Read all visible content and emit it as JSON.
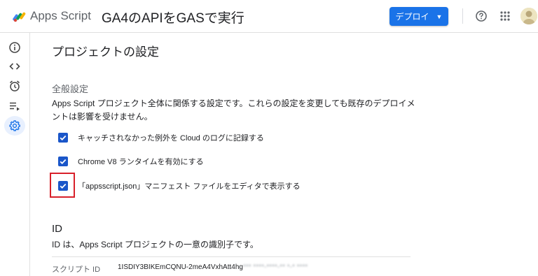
{
  "header": {
    "app_name": "Apps Script",
    "project_title": "GA4のAPIをGASで実行",
    "deploy_label": "デプロイ",
    "deploy_caret": "▼",
    "accent_color": "#1a73e8"
  },
  "sidebar": {
    "items": [
      {
        "name": "overview",
        "icon": "info-icon"
      },
      {
        "name": "editor",
        "icon": "code-icon"
      },
      {
        "name": "triggers",
        "icon": "alarm-clock-icon"
      },
      {
        "name": "executions",
        "icon": "executions-list-icon"
      },
      {
        "name": "settings",
        "icon": "gear-icon",
        "active": true
      }
    ]
  },
  "main": {
    "page_title": "プロジェクトの設定",
    "general": {
      "title": "全般設定",
      "description": "Apps Script プロジェクト全体に関係する設定です。これらの設定を変更しても既存のデプロイメントは影響を受けません。",
      "options": [
        {
          "label": "キャッチされなかった例外を Cloud のログに記録する",
          "checked": true
        },
        {
          "label": "Chrome V8 ランタイムを有効にする",
          "checked": true
        },
        {
          "label": "「appsscript.json」マニフェスト ファイルをエディタで表示する",
          "checked": true
        }
      ]
    },
    "id_section": {
      "title": "ID",
      "description": "ID は、Apps Script プロジェクトの一意の識別子です。",
      "script_id_label": "スクリプト ID",
      "script_id_value": "1ISDIY3BIKEmCQNU-2meA4VxhAtt4hg",
      "script_id_redacted": "*** ****-****-** *-* ****"
    }
  }
}
